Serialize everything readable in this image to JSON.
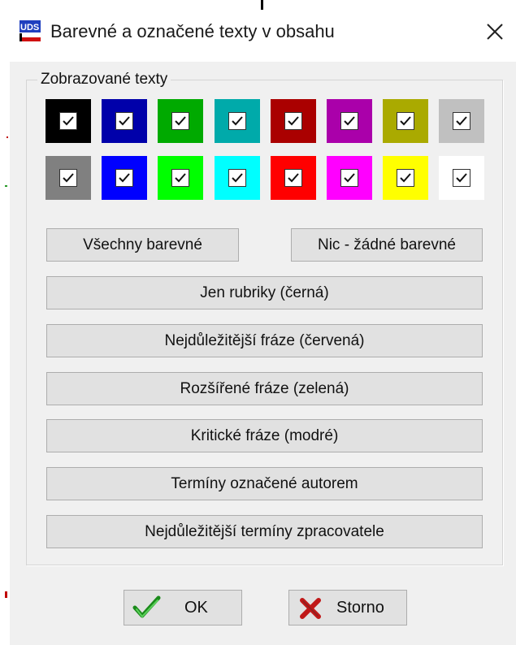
{
  "window": {
    "title": "Barevné a označené texty v obsahu",
    "close_glyph": "✕",
    "app_icon": "app-logo-icon"
  },
  "group": {
    "label": "Zobrazované texty"
  },
  "swatches": {
    "row1": [
      {
        "name": "black",
        "color": "#000000"
      },
      {
        "name": "dark-blue",
        "color": "#0000aa"
      },
      {
        "name": "dark-green",
        "color": "#00aa00"
      },
      {
        "name": "dark-cyan",
        "color": "#00aaaa"
      },
      {
        "name": "dark-red",
        "color": "#aa0000"
      },
      {
        "name": "dark-magenta",
        "color": "#aa00aa"
      },
      {
        "name": "dark-yellow",
        "color": "#aaaa00"
      },
      {
        "name": "light-gray",
        "color": "#c0c0c0"
      }
    ],
    "row2": [
      {
        "name": "dark-gray",
        "color": "#808080"
      },
      {
        "name": "blue",
        "color": "#0000ff"
      },
      {
        "name": "green",
        "color": "#00ff00"
      },
      {
        "name": "cyan",
        "color": "#00ffff"
      },
      {
        "name": "red",
        "color": "#ff0000"
      },
      {
        "name": "magenta",
        "color": "#ff00ff"
      },
      {
        "name": "yellow",
        "color": "#ffff00"
      },
      {
        "name": "white",
        "color": "#ffffff"
      }
    ]
  },
  "buttons": {
    "all_colored": "Všechny barevné",
    "none_colored": "Nic - žádné barevné",
    "headings_only": "Jen rubriky (černá)",
    "most_important": "Nejdůležitější fráze (červená)",
    "extended": "Rozšířené fráze (zelená)",
    "critical": "Kritické fráze (modré)",
    "author_terms": "Termíny označené autorem",
    "processor_terms": "Nejdůležitější termíny zpracovatele"
  },
  "footer": {
    "ok": "OK",
    "cancel": "Storno",
    "ok_icon": "checkmark-icon",
    "cancel_icon": "x-icon"
  }
}
